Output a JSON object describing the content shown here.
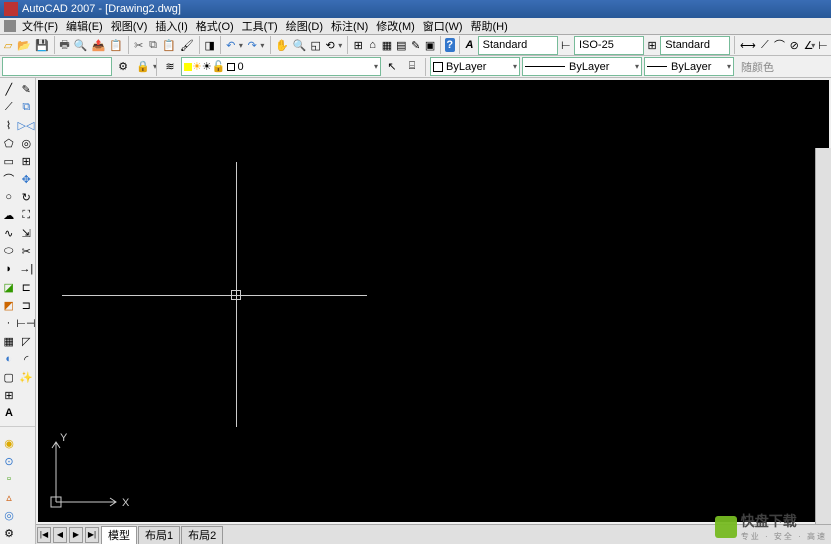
{
  "titlebar": {
    "text": "AutoCAD 2007 - [Drawing2.dwg]"
  },
  "menubar": {
    "items": [
      "文件(F)",
      "编辑(E)",
      "视图(V)",
      "插入(I)",
      "格式(O)",
      "工具(T)",
      "绘图(D)",
      "标注(N)",
      "修改(M)",
      "窗口(W)",
      "帮助(H)"
    ]
  },
  "toolbar1": {
    "style_combo": "Standard",
    "dimstyle_combo": "ISO-25",
    "table_combo": "Standard"
  },
  "toolbar2": {
    "left_combo": "",
    "layer_combo": "0",
    "color_combo": "■ ByLayer",
    "linetype_combo": "ByLayer",
    "lineweight_combo": "ByLayer",
    "colorbtn": "随颜色"
  },
  "tabs": {
    "nav": [
      "|◀",
      "◀",
      "▶",
      "▶|"
    ],
    "items": [
      "模型",
      "布局1",
      "布局2"
    ]
  },
  "ucs": {
    "x": "X",
    "y": "Y"
  },
  "watermark": {
    "main": "快盘下载",
    "sub": "专业 · 安全 · 高速"
  },
  "colors": {
    "canvas_bg": "#000000",
    "crosshair": "#cccccc",
    "ui_bg": "#f0f0f0"
  }
}
